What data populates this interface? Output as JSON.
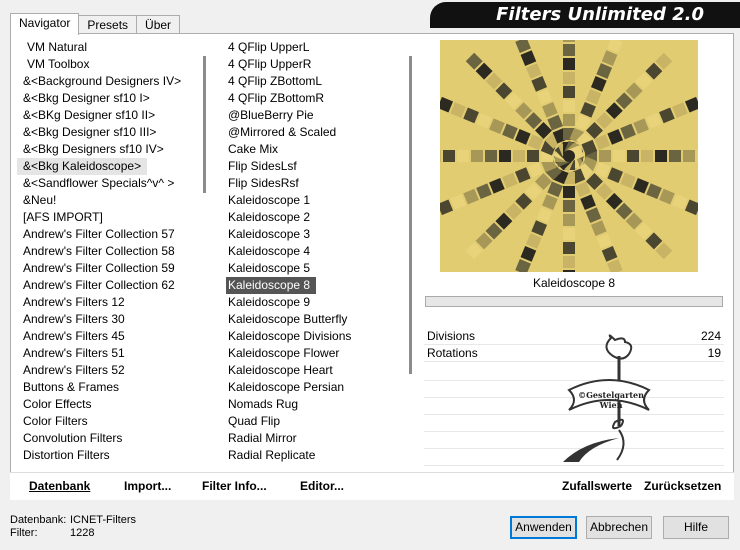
{
  "tabs": [
    "Navigator",
    "Presets",
    "Über"
  ],
  "banner_title": "Filters Unlimited 2.0",
  "categories": [
    "VM Natural",
    "VM Toolbox",
    "&<Background Designers IV>",
    "&<Bkg Designer sf10 I>",
    "&<BKg Designer sf10 II>",
    "&<Bkg Designer sf10 III>",
    "&<Bkg Designers sf10 IV>",
    "&<Bkg Kaleidoscope>",
    "&<Sandflower Specials^v^ >",
    "&Neu!",
    "[AFS IMPORT]",
    "Andrew's Filter Collection 57",
    "Andrew's Filter Collection 58",
    "Andrew's Filter Collection 59",
    "Andrew's Filter Collection 62",
    "Andrew's Filters 12",
    "Andrew's Filters 30",
    "Andrew's Filters 45",
    "Andrew's Filters 51",
    "Andrew's Filters 52",
    "Buttons & Frames",
    "Color Effects",
    "Color Filters",
    "Convolution Filters",
    "Distortion Filters"
  ],
  "selected_category": "&<Bkg Kaleidoscope>",
  "filters": [
    "4 QFlip UpperL",
    "4 QFlip UpperR",
    "4 QFlip ZBottomL",
    "4 QFlip ZBottomR",
    "@BlueBerry Pie",
    "@Mirrored & Scaled",
    "Cake Mix",
    "Flip SidesLsf",
    "Flip SidesRsf",
    "Kaleidoscope 1",
    "Kaleidoscope 2",
    "Kaleidoscope 3",
    "Kaleidoscope 4",
    "Kaleidoscope 5",
    "Kaleidoscope 8",
    "Kaleidoscope 9",
    "Kaleidoscope Butterfly",
    "Kaleidoscope Divisions",
    "Kaleidoscope Flower",
    "Kaleidoscope Heart",
    "Kaleidoscope Persian",
    "Nomads Rug",
    "Quad Flip",
    "Radial Mirror",
    "Radial Replicate"
  ],
  "selected_filter": "Kaleidoscope 8",
  "preview_label": "Kaleidoscope 8",
  "params": [
    {
      "name": "Divisions",
      "value": "224"
    },
    {
      "name": "Rotations",
      "value": "19"
    }
  ],
  "watermark_text": [
    "©Gestelgarten",
    "Wien"
  ],
  "toolbar": {
    "datenbank": "Datenbank",
    "import": "Import...",
    "filter_info": "Filter Info...",
    "editor": "Editor...",
    "zufallswerte": "Zufallswerte",
    "zuruecksetzen": "Zurücksetzen"
  },
  "footer": {
    "db_label": "Datenbank:",
    "db_value": "ICNET-Filters",
    "filter_label": "Filter:",
    "filter_value": "1228"
  },
  "buttons": {
    "apply": "Anwenden",
    "cancel": "Abbrechen",
    "help": "Hilfe"
  },
  "colors": {
    "preview_yellow": "#e8d27a",
    "preview_dark": "#2a2a22",
    "selection": "#555555",
    "accent": "#0078d7"
  }
}
